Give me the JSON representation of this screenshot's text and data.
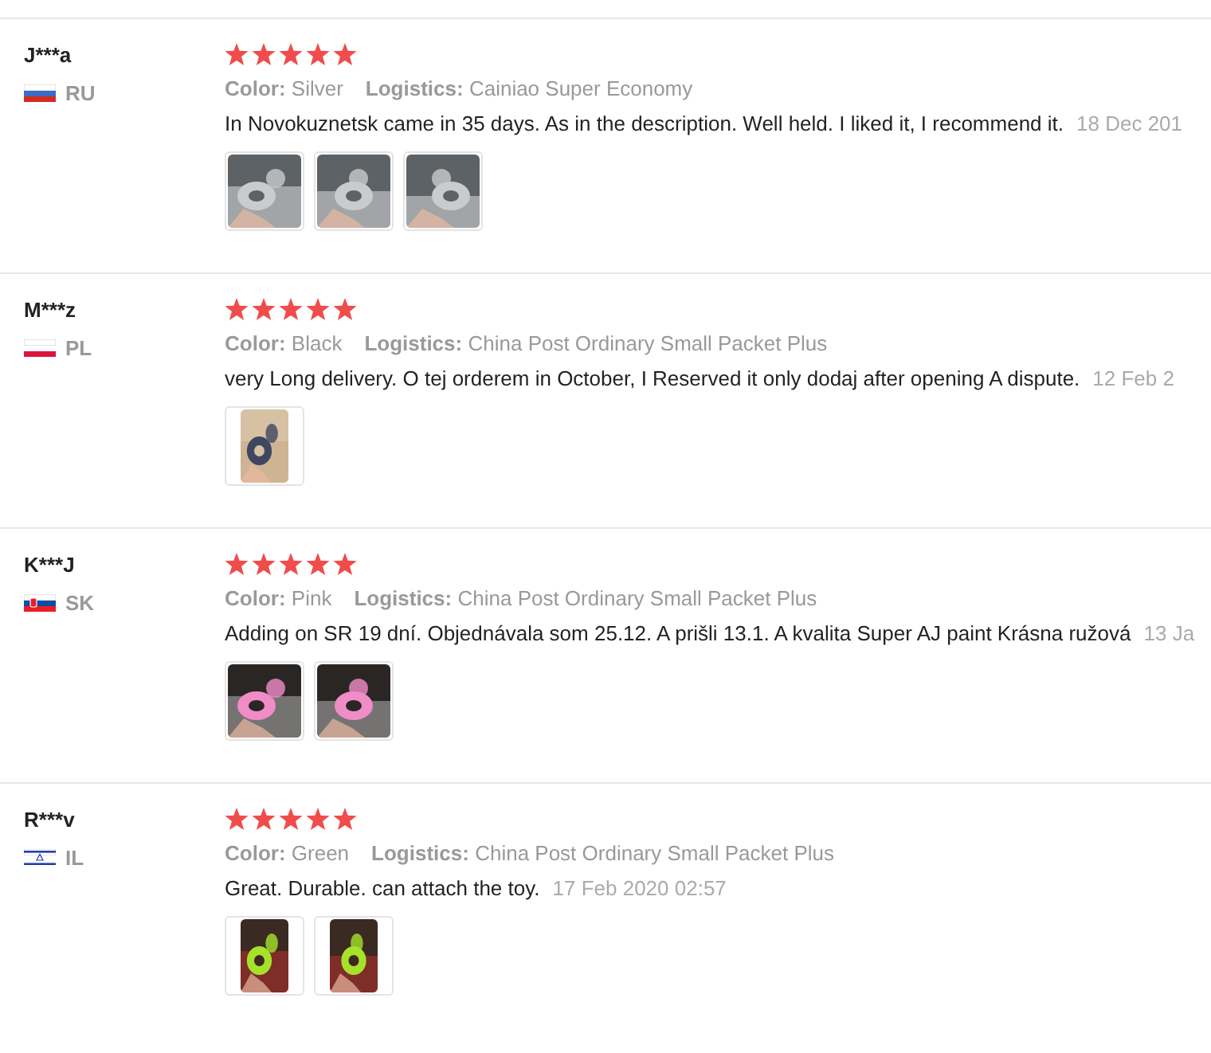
{
  "reviews": [
    {
      "name": "J***a",
      "flag": {
        "kind": "ru"
      },
      "country": "RU",
      "stars": 5,
      "color_label": "Color:",
      "color_value": "Silver",
      "logistics_label": "Logistics:",
      "logistics": "Cainiao Super Economy",
      "text": "In Novokuznetsk came in 35 days. As in the description. Well held. I liked it, I recommend it.",
      "date": "18 Dec 201",
      "photos": [
        {
          "kind": "picture"
        },
        {
          "kind": "picture"
        },
        {
          "kind": "picture"
        }
      ]
    },
    {
      "name": "M***z",
      "flag": {
        "kind": "pl"
      },
      "country": "PL",
      "stars": 5,
      "color_label": "Color:",
      "color_value": "Black",
      "logistics_label": "Logistics:",
      "logistics": "China Post Ordinary Small Packet Plus",
      "text": "very Long delivery. O tej orderem in October, I Reserved it only dodaj after opening A dispute.",
      "date": "12 Feb 2",
      "photos": [
        {
          "kind": "picture"
        }
      ]
    },
    {
      "name": "K***J",
      "flag": {
        "kind": "sk"
      },
      "country": "SK",
      "stars": 5,
      "color_label": "Color:",
      "color_value": "Pink",
      "logistics_label": "Logistics:",
      "logistics": "China Post Ordinary Small Packet Plus",
      "text": "Adding on SR 19 dní. Objednávala som 25.12. A prišli 13.1. A kvalita Super AJ paint Krásna ružová",
      "date": "13 Ja",
      "photos": [
        {
          "kind": "picture"
        },
        {
          "kind": "picture"
        }
      ]
    },
    {
      "name": "R***v",
      "flag": {
        "kind": "il"
      },
      "country": "IL",
      "stars": 5,
      "color_label": "Color:",
      "color_value": "Green",
      "logistics_label": "Logistics:",
      "logistics": "China Post Ordinary Small Packet Plus",
      "text": "Great. Durable. can attach the toy.",
      "date": "17 Feb 2020 02:57",
      "photos": [
        {
          "kind": "picture"
        },
        {
          "kind": "picture"
        }
      ]
    }
  ]
}
